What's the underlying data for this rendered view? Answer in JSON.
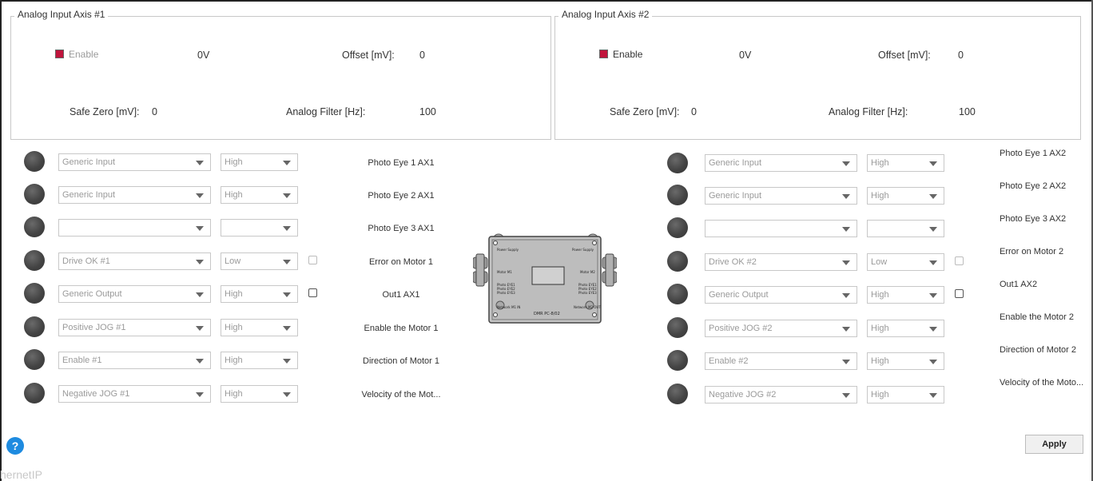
{
  "axis1": {
    "title": "Analog Input Axis #1",
    "enable_label": "Enable",
    "voltage": "0V",
    "offset_label": "Offset [mV]:",
    "offset_value": "0",
    "safe_zero_label": "Safe Zero [mV]:",
    "safe_zero_value": "0",
    "filter_label": "Analog Filter [Hz]:",
    "filter_value": "100"
  },
  "axis2": {
    "title": "Analog Input Axis #2",
    "enable_label": "Enable",
    "voltage": "0V",
    "offset_label": "Offset [mV]:",
    "offset_value": "0",
    "safe_zero_label": "Safe Zero [mV]:",
    "safe_zero_value": "0",
    "filter_label": "Analog Filter [Hz]:",
    "filter_value": "100"
  },
  "io_left": [
    {
      "function": "Generic Input",
      "level": "High",
      "label": "Photo Eye 1 AX1"
    },
    {
      "function": "Generic Input",
      "level": "High",
      "label": "Photo Eye 2 AX1"
    },
    {
      "function": "",
      "level": "",
      "label": "Photo Eye 3 AX1"
    },
    {
      "function": "Drive OK #1",
      "level": "Low",
      "label": "Error on Motor 1"
    },
    {
      "function": "Generic Output",
      "level": "High",
      "label": "Out1 AX1"
    },
    {
      "function": "Positive JOG #1",
      "level": "High",
      "label": "Enable the Motor 1"
    },
    {
      "function": "Enable #1",
      "level": "High",
      "label": "Direction of Motor 1"
    },
    {
      "function": "Negative JOG #1",
      "level": "High",
      "label": "Velocity of the Mot..."
    }
  ],
  "io_right": [
    {
      "function": "Generic Input",
      "level": "High",
      "label": "Photo Eye 1 AX2"
    },
    {
      "function": "Generic Input",
      "level": "High",
      "label": "Photo Eye 2 AX2"
    },
    {
      "function": "",
      "level": "",
      "label": "Photo Eye 3 AX2"
    },
    {
      "function": "Drive OK #2",
      "level": "Low",
      "label": "Error on Motor 2"
    },
    {
      "function": "Generic Output",
      "level": "High",
      "label": "Out1 AX2"
    },
    {
      "function": "Positive JOG #2",
      "level": "High",
      "label": "Enable the Motor 2"
    },
    {
      "function": "Enable #2",
      "level": "High",
      "label": "Direction of Motor 2"
    },
    {
      "function": "Negative JOG #2",
      "level": "High",
      "label": "Velocity of the Moto..."
    }
  ],
  "device": {
    "power_supply": "Power Supply",
    "motor_m1": "Motor M1",
    "motor_m2": "Motor M2",
    "eye_l1": "Photo EYE1",
    "eye_l2": "Photo EYE2",
    "eye_l3": "Photo EYE3",
    "network": "Network  M1  IN",
    "network_r": "Network  M2  OUT",
    "model": "DMR PC-8/02"
  },
  "help_label": "?",
  "apply_label": "Apply",
  "footer_text": "hernetIP",
  "colors": {
    "enable_checked": "#c0143c",
    "help_blue": "#1e8be0"
  }
}
